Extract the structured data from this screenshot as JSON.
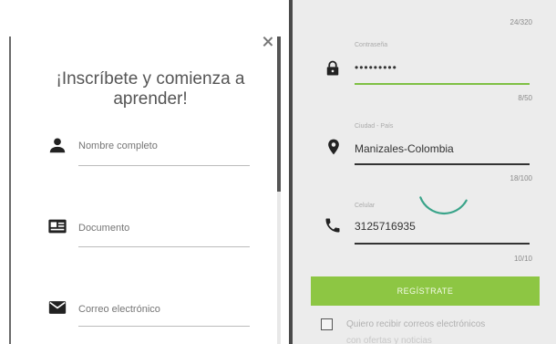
{
  "signup_modal": {
    "title": "¡Inscríbete y comienza a aprender!",
    "fields": [
      {
        "placeholder": "Nombre completo",
        "icon": "person-icon"
      },
      {
        "placeholder": "Documento",
        "icon": "id-card-icon"
      },
      {
        "placeholder": "Correo electrónico",
        "icon": "mail-icon"
      }
    ]
  },
  "form_right": {
    "top_counter": "24/320",
    "password": {
      "label": "Contraseña",
      "value": "•••••••••",
      "counter": "8/50",
      "icon": "lock-icon"
    },
    "city": {
      "label": "Ciudad - País",
      "value": "Manizales-Colombia",
      "counter": "18/100",
      "icon": "location-pin-icon"
    },
    "phone": {
      "label": "Celular",
      "value": "3125716935",
      "counter": "10/10",
      "icon": "phone-icon"
    },
    "register_label": "REGÍSTRATE",
    "consent_text": "Quiero recibir correos electrónicos",
    "consent_text_2": "con ofertas y noticias"
  },
  "colors": {
    "accent": "#8dc643",
    "line_active": "#7fc044",
    "spinner": "#3aa48a"
  }
}
